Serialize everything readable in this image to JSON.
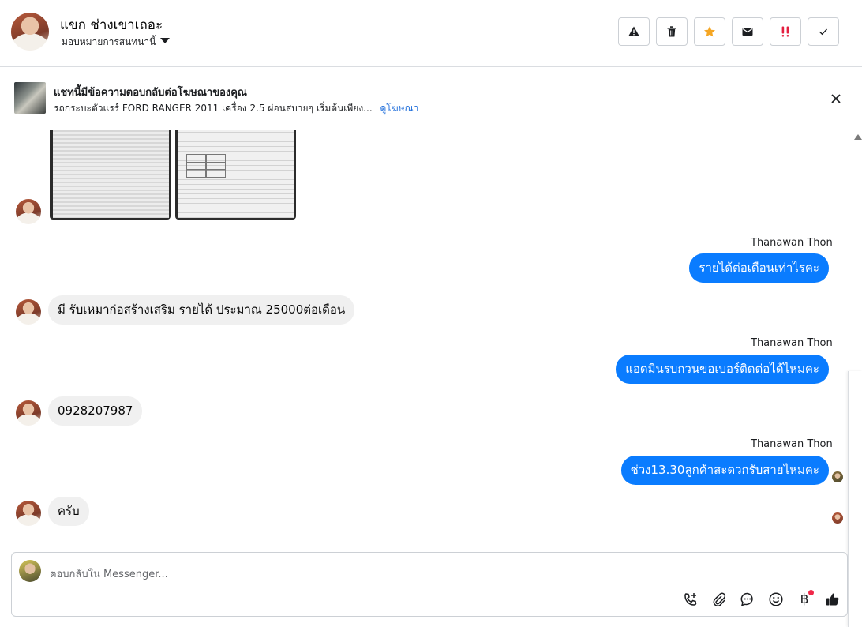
{
  "header": {
    "contact_name": "แขก ช่างเขาเถอะ",
    "assign_label": "มอบหมายการสนทนานี้",
    "actions": [
      {
        "name": "spam-icon",
        "color": "#1c1e21"
      },
      {
        "name": "trash-icon",
        "color": "#1c1e21"
      },
      {
        "name": "star-icon",
        "color": "#f5a623"
      },
      {
        "name": "mail-icon",
        "color": "#1c1e21"
      },
      {
        "name": "important-icon",
        "color": "#e41e3f"
      },
      {
        "name": "check-icon",
        "color": "#1c1e21"
      }
    ]
  },
  "ad_banner": {
    "title": "แชทนี้มีข้อความตอบกลับต่อโฆษณาของคุณ",
    "description": "รถกระบะตัวแรร์ FORD RANGER 2011 เครื่อง 2.5 ผ่อนสบายๆ เริ่มต้นเพียง...",
    "link": "ดูโฆษณา"
  },
  "messages": [
    {
      "sender": "Thanawan Thon",
      "text": "รายได้ต่อเดือนเท่าไรคะ"
    },
    {
      "text": "มี รับเหมาก่อสร้างเสริม รายได้ ประมาณ 25000ต่อเดือน"
    },
    {
      "sender": "Thanawan Thon",
      "text": "แอดมินรบกวนขอเบอร์ติดต่อได้ไหมคะ"
    },
    {
      "text": "0928207987"
    },
    {
      "sender": "Thanawan Thon",
      "text": "ช่วง13.30ลูกค้าสะดวกรับสายไหมคะ"
    },
    {
      "text": "ครับ"
    }
  ],
  "composer": {
    "placeholder": "ตอบกลับใน Messenger...",
    "currency_symbol": "฿",
    "accent": "#0a7cff"
  }
}
